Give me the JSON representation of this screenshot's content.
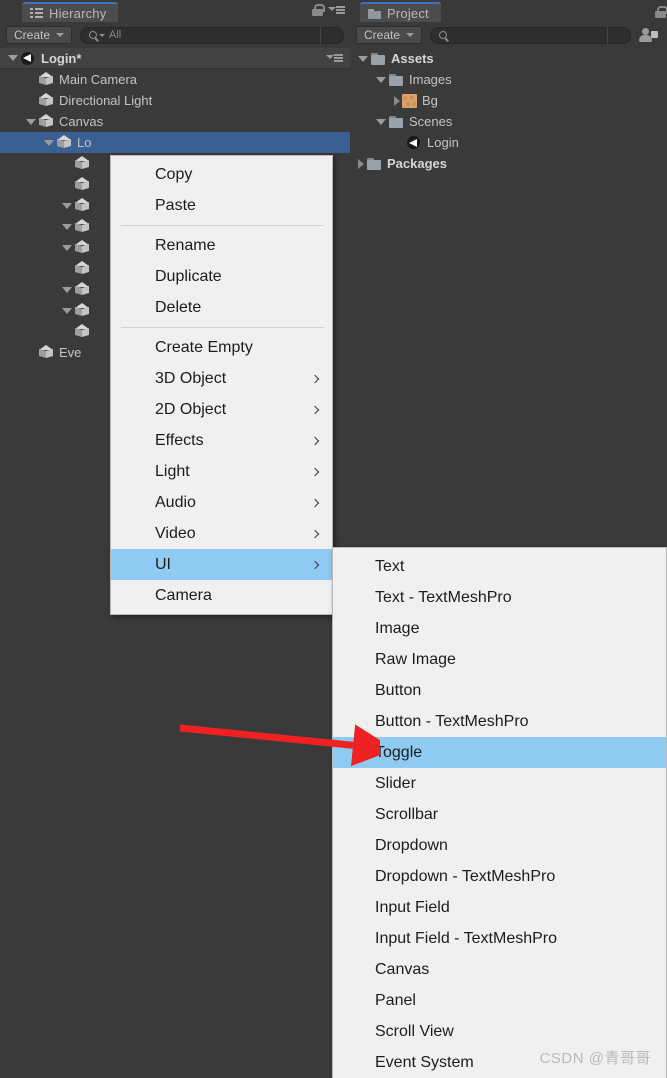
{
  "hierarchy": {
    "tab_label": "Hierarchy",
    "tab_icon": "hierarchy-list-icon",
    "create_label": "Create",
    "search_value": "All",
    "lock_icon": "lock-icon",
    "menu_icon": "kebab-menu-icon",
    "scene_root": {
      "label": "Login*",
      "icon": "unity-scene-icon",
      "expanded": true
    },
    "items": [
      {
        "label": "Main Camera",
        "indent": 2,
        "icon": "cube-icon",
        "arrow": "none"
      },
      {
        "label": "Directional Light",
        "indent": 2,
        "icon": "cube-icon",
        "arrow": "none"
      },
      {
        "label": "Canvas",
        "indent": 2,
        "icon": "cube-icon",
        "arrow": "expanded"
      },
      {
        "label": "Lo",
        "indent": 3,
        "icon": "cube-icon",
        "arrow": "expanded",
        "selected": true
      },
      {
        "label": "",
        "indent": 4,
        "icon": "cube-icon",
        "arrow": "none"
      },
      {
        "label": "",
        "indent": 4,
        "icon": "cube-icon",
        "arrow": "none"
      },
      {
        "label": "",
        "indent": 4,
        "icon": "cube-icon",
        "arrow": "expanded"
      },
      {
        "label": "",
        "indent": 4,
        "icon": "cube-icon",
        "arrow": "expanded"
      },
      {
        "label": "",
        "indent": 4,
        "icon": "cube-icon",
        "arrow": "expanded"
      },
      {
        "label": "",
        "indent": 4,
        "icon": "cube-icon",
        "arrow": "none"
      },
      {
        "label": "",
        "indent": 4,
        "icon": "cube-icon",
        "arrow": "expanded"
      },
      {
        "label": "",
        "indent": 4,
        "icon": "cube-icon",
        "arrow": "expanded"
      },
      {
        "label": "",
        "indent": 4,
        "icon": "cube-icon",
        "arrow": "none"
      },
      {
        "label": "Eve",
        "indent": 2,
        "icon": "cube-icon",
        "arrow": "none"
      }
    ]
  },
  "project": {
    "tab_label": "Project",
    "tab_icon": "folder-icon",
    "create_label": "Create",
    "search_value": "",
    "avatar_icon": "collab-user-icon",
    "lock_icon": "lock-icon",
    "items": [
      {
        "label": "Assets",
        "indent": 1,
        "icon": "folder-icon",
        "arrow": "expanded",
        "bold": true
      },
      {
        "label": "Images",
        "indent": 2,
        "icon": "folder-icon",
        "arrow": "expanded",
        "bold": false
      },
      {
        "label": "Bg",
        "indent": 3,
        "icon": "texture-icon",
        "arrow": "collapsed",
        "bold": false
      },
      {
        "label": "Scenes",
        "indent": 2,
        "icon": "folder-icon",
        "arrow": "expanded",
        "bold": false
      },
      {
        "label": "Login",
        "indent": 3,
        "icon": "unity-scene-icon",
        "arrow": "none",
        "bold": false
      },
      {
        "label": "Packages",
        "indent": 1,
        "icon": "folder-icon",
        "arrow": "collapsed",
        "bold": true
      }
    ]
  },
  "context_menu": {
    "items": [
      {
        "label": "Copy",
        "type": "item"
      },
      {
        "label": "Paste",
        "type": "item"
      },
      {
        "type": "separator"
      },
      {
        "label": "Rename",
        "type": "item"
      },
      {
        "label": "Duplicate",
        "type": "item"
      },
      {
        "label": "Delete",
        "type": "item"
      },
      {
        "type": "separator"
      },
      {
        "label": "Create Empty",
        "type": "item"
      },
      {
        "label": "3D Object",
        "type": "item",
        "submenu": true
      },
      {
        "label": "2D Object",
        "type": "item",
        "submenu": true
      },
      {
        "label": "Effects",
        "type": "item",
        "submenu": true
      },
      {
        "label": "Light",
        "type": "item",
        "submenu": true
      },
      {
        "label": "Audio",
        "type": "item",
        "submenu": true
      },
      {
        "label": "Video",
        "type": "item",
        "submenu": true
      },
      {
        "label": "UI",
        "type": "item",
        "submenu": true,
        "highlighted": true
      },
      {
        "label": "Camera",
        "type": "item"
      }
    ]
  },
  "ui_submenu": {
    "items": [
      {
        "label": "Text"
      },
      {
        "label": "Text - TextMeshPro"
      },
      {
        "label": "Image"
      },
      {
        "label": "Raw Image"
      },
      {
        "label": "Button"
      },
      {
        "label": "Button - TextMeshPro"
      },
      {
        "label": "Toggle",
        "highlighted": true
      },
      {
        "label": "Slider"
      },
      {
        "label": "Scrollbar"
      },
      {
        "label": "Dropdown"
      },
      {
        "label": "Dropdown - TextMeshPro"
      },
      {
        "label": "Input Field"
      },
      {
        "label": "Input Field - TextMeshPro"
      },
      {
        "label": "Canvas"
      },
      {
        "label": "Panel"
      },
      {
        "label": "Scroll View"
      },
      {
        "label": "Event System"
      }
    ]
  },
  "annotation": {
    "arrow_color": "#ee2222",
    "points_to": "Toggle"
  },
  "watermark": {
    "text": "CSDN @青哥哥"
  },
  "colors": {
    "panel_bg": "#3a3a3a",
    "selection_blue": "#3a5f93",
    "menu_highlight": "#8fcaf3",
    "menu_bg": "#f0f0f0",
    "active_tab_underline": "#3b74c4"
  }
}
